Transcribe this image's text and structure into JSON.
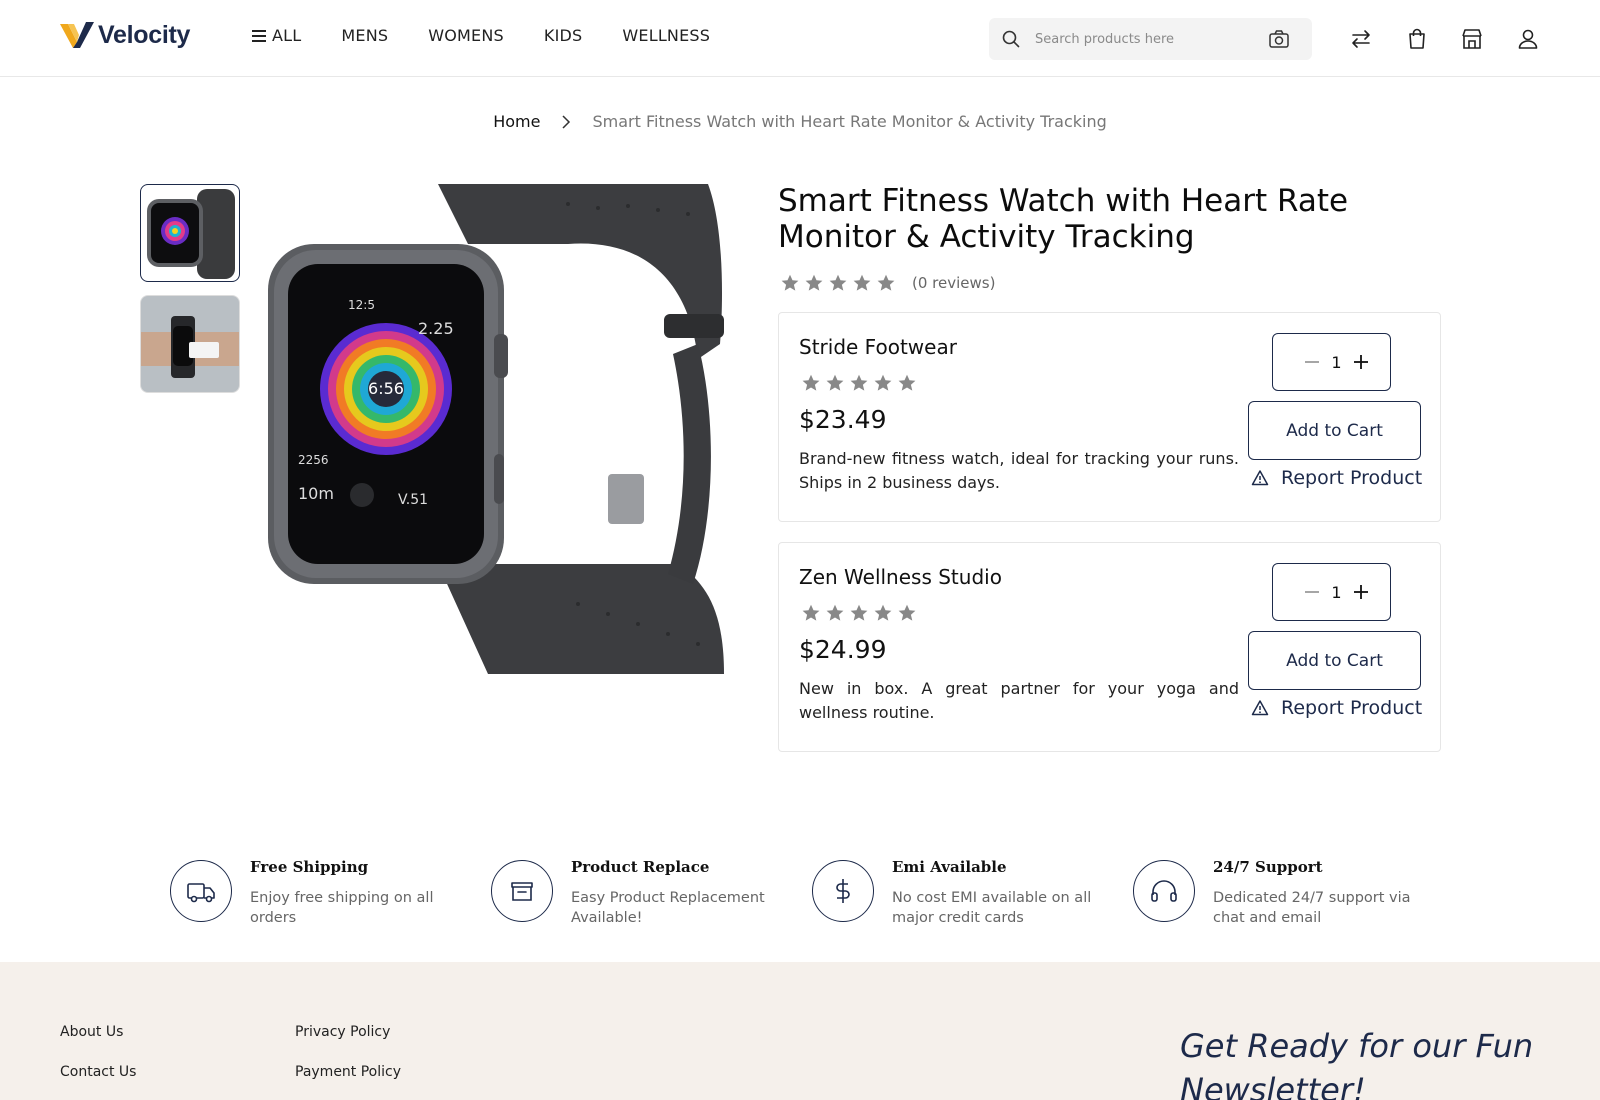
{
  "brand": {
    "name": "Velocity"
  },
  "nav": {
    "items": [
      "ALL",
      "MENS",
      "WOMENS",
      "KIDS",
      "WELLNESS"
    ]
  },
  "search": {
    "placeholder": "Search products here"
  },
  "breadcrumb": {
    "home": "Home",
    "current": "Smart Fitness Watch with Heart Rate Monitor & Activity Tracking"
  },
  "product": {
    "title": "Smart Fitness Watch with Heart Rate Monitor & Activity Tracking",
    "rating": 0,
    "reviews_text": "(0 reviews)"
  },
  "sellers": [
    {
      "name": "Stride Footwear",
      "rating": 0,
      "price": "$23.49",
      "description": "Brand-new fitness watch, ideal for tracking your runs. Ships in 2 business days.",
      "quantity": "1",
      "add_label": "Add to Cart",
      "report_label": "Report Product"
    },
    {
      "name": "Zen Wellness Studio",
      "rating": 0,
      "price": "$24.99",
      "description": "New in box. A great partner for your yoga and wellness routine.",
      "quantity": "1",
      "add_label": "Add to Cart",
      "report_label": "Report Product"
    }
  ],
  "features": [
    {
      "title": "Free Shipping",
      "desc": "Enjoy free shipping on all orders",
      "icon": "truck-icon"
    },
    {
      "title": "Product Replace",
      "desc": "Easy Product Replacement Available!",
      "icon": "box-icon"
    },
    {
      "title": "Emi Available",
      "desc": "No cost EMI available on all major credit cards",
      "icon": "dollar-icon"
    },
    {
      "title": "24/7 Support",
      "desc": "Dedicated 24/7 support via chat and email",
      "icon": "headset-icon"
    }
  ],
  "footer": {
    "links": [
      "About Us",
      "Contact Us",
      "Privacy Policy",
      "Payment Policy"
    ],
    "newsletter": "Get Ready for our Fun Newsletter!"
  },
  "colors": {
    "navy": "#1d2a4a",
    "logo_gold": "#f0a81c",
    "footer_bg": "#f5f0eb",
    "star_gray": "#888888"
  }
}
